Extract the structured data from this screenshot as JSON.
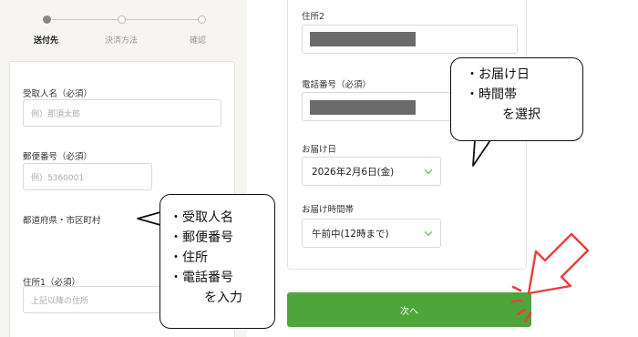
{
  "stepper": {
    "steps": [
      {
        "label": "送付先",
        "active": true
      },
      {
        "label": "決済方法",
        "active": false
      },
      {
        "label": "確認",
        "active": false
      }
    ]
  },
  "form": {
    "recipient_name": {
      "label": "受取人名（必須）",
      "placeholder": "例）那須太郎"
    },
    "postal_code": {
      "label": "郵便番号（必須）",
      "placeholder": "例）5360001"
    },
    "prefecture": {
      "label": "都道府県・市区町村"
    },
    "address1": {
      "label": "住所1（必須）",
      "placeholder": "上記以降の住所"
    },
    "address2": {
      "label": "住所2"
    },
    "phone": {
      "label": "電話番号（必須）"
    },
    "delivery_date": {
      "label": "お届け日",
      "value": "2026年2月6日(金)"
    },
    "delivery_time": {
      "label": "お届け時間帯",
      "value": "午前中(12時まで)"
    },
    "next_button": "次へ"
  },
  "annotations": {
    "left_bubble": [
      "・受取人名",
      "・郵便番号",
      "・住所",
      "・電話番号",
      "を入力"
    ],
    "right_bubble": [
      "・お届け日",
      "・時間帯",
      "を選択"
    ]
  },
  "colors": {
    "accent_green": "#4ea53b",
    "pointer_red": "#e8403a"
  }
}
